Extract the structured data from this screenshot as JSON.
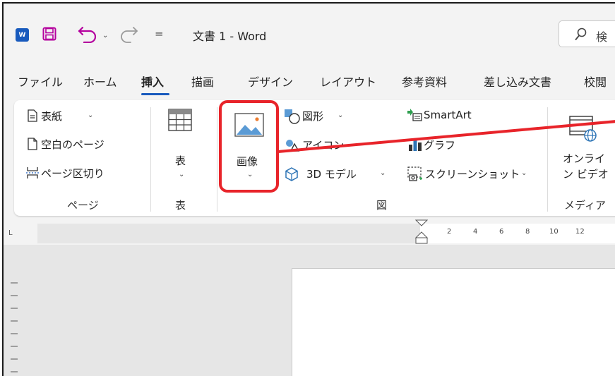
{
  "titlebar": {
    "app_icon_letter": "W",
    "doc_title": "文書 1  -  Word",
    "qat_more": "=",
    "undo_dropdown": "⌄",
    "search_text": "検"
  },
  "tabs": [
    {
      "label": "ファイル"
    },
    {
      "label": "ホーム"
    },
    {
      "label": "挿入"
    },
    {
      "label": "描画"
    },
    {
      "label": "デザイン"
    },
    {
      "label": "レイアウト"
    },
    {
      "label": "参考資料"
    },
    {
      "label": "差し込み文書"
    },
    {
      "label": "校閲"
    }
  ],
  "ribbon": {
    "pages": {
      "cover": "表紙",
      "blank": "空白のページ",
      "break": "ページ区切り",
      "group_label": "ページ"
    },
    "table": {
      "button": "表",
      "group_label": "表"
    },
    "illustrations": {
      "picture": "画像",
      "shapes": "図形",
      "icons": "アイコン",
      "models3d": "3D モデル",
      "smartart": "SmartArt",
      "chart": "グラフ",
      "screenshot": "スクリーンショット",
      "group_label": "図"
    },
    "media": {
      "online_video_line1": "オンライ",
      "online_video_line2": "ン ビデオ",
      "group_label": "メディア"
    },
    "chevron": "⌄"
  },
  "ruler": {
    "corner": "L",
    "numbers": [
      "2",
      "4",
      "6",
      "8",
      "10",
      "12"
    ]
  },
  "colors": {
    "accent": "#185abd",
    "highlight": "#e8242a",
    "chrome": "#f3f3f3",
    "canvas": "#e6e6e6"
  }
}
